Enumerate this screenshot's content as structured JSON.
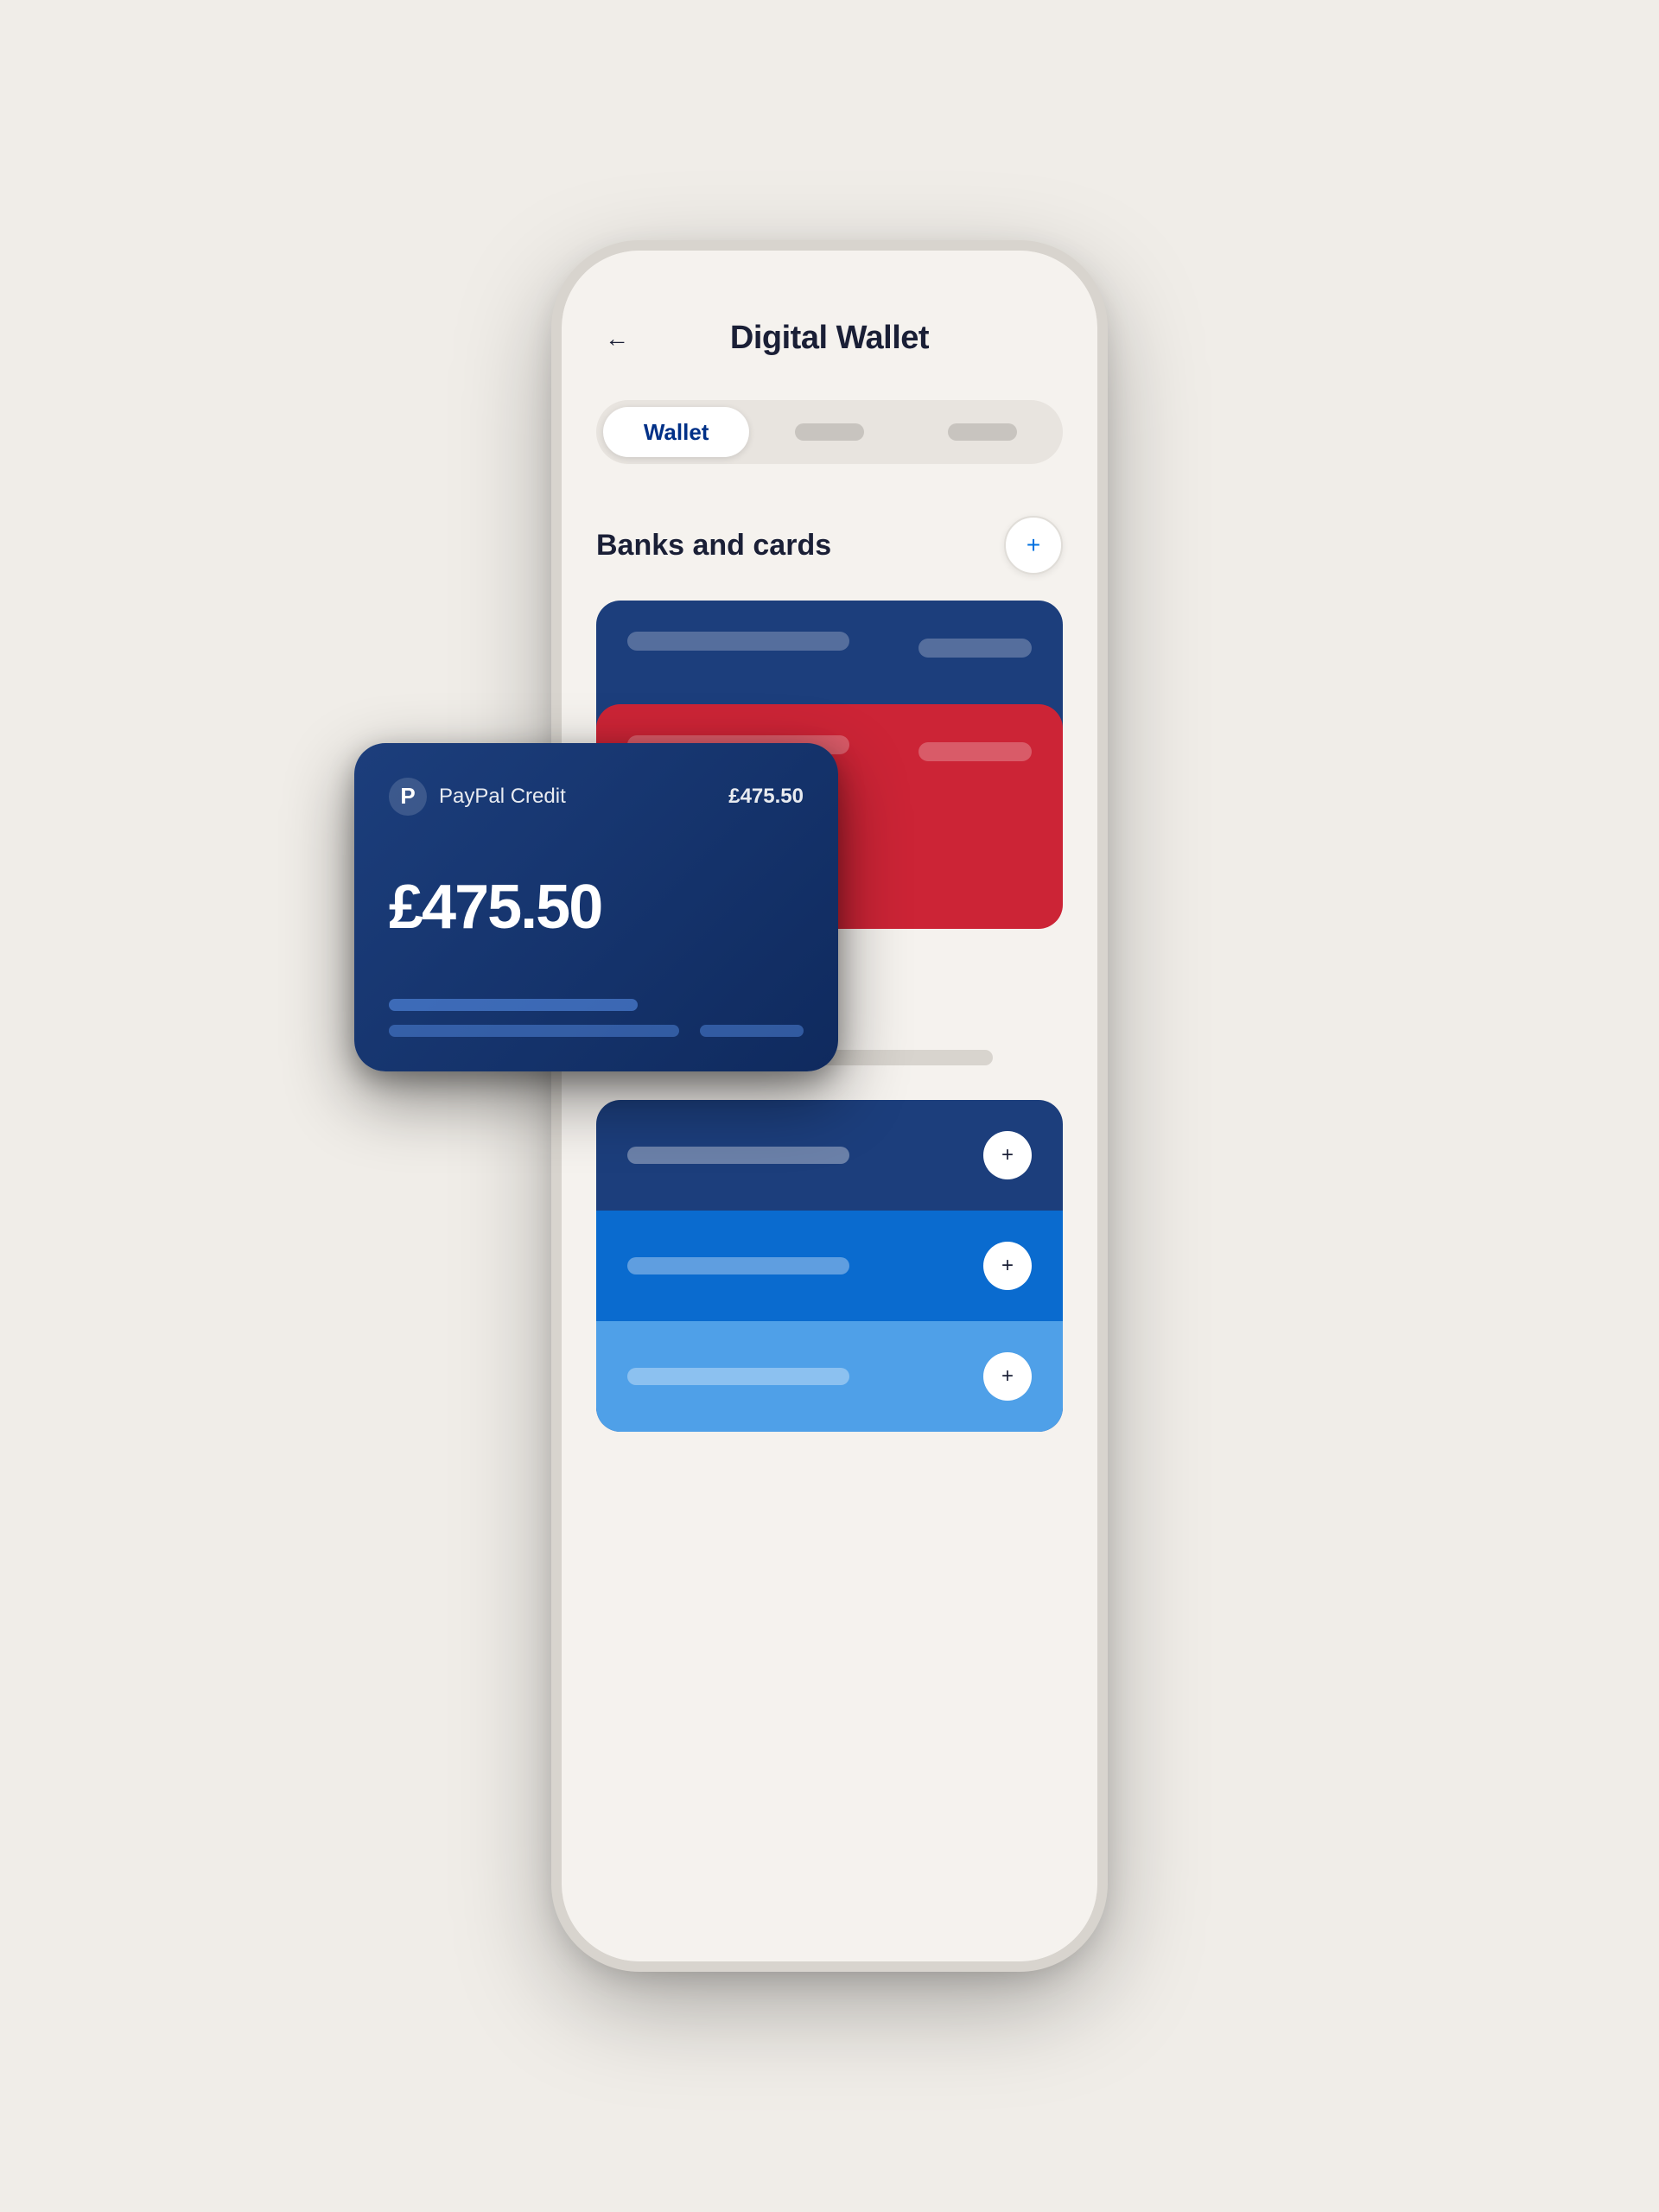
{
  "page": {
    "background": "#f0ede8"
  },
  "header": {
    "back_label": "←",
    "title": "Digital Wallet"
  },
  "tabs": {
    "active": "Wallet",
    "items": [
      {
        "id": "wallet",
        "label": "Wallet",
        "active": true
      },
      {
        "id": "tab2",
        "label": "",
        "active": false
      },
      {
        "id": "tab3",
        "label": "",
        "active": false
      }
    ]
  },
  "section": {
    "title": "Banks and cards",
    "add_icon": "+"
  },
  "floating_card": {
    "brand": "PayPal Credit",
    "balance_label": "£475.50",
    "amount": "£475.50"
  },
  "add_options": [
    {
      "id": "opt1",
      "add_icon": "+"
    },
    {
      "id": "opt2",
      "add_icon": "+"
    },
    {
      "id": "opt3",
      "add_icon": "+"
    }
  ]
}
